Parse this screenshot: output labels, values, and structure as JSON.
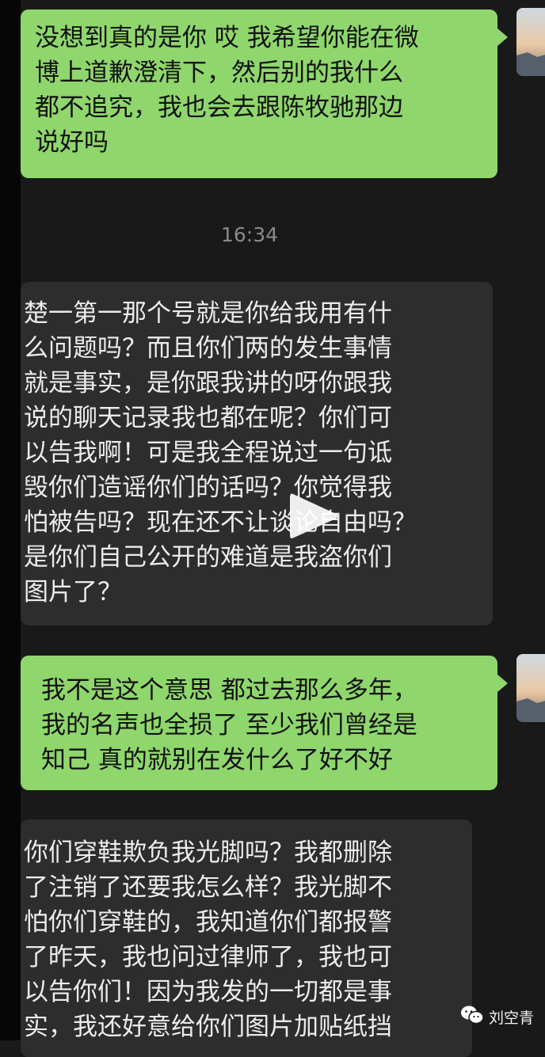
{
  "chat": {
    "messages": [
      {
        "direction": "outgoing",
        "text": "没想到真的是你 哎 我希望你能在微\n博上道歉澄清下，然后别的我什么\n都不追究，我也会去跟陈牧驰那边\n说好吗"
      },
      {
        "direction": "incoming",
        "text": "楚一第一那个号就是你给我用有什\n么问题吗？而且你们两的发生事情\n就是事实，是你跟我讲的呀你跟我\n说的聊天记录我也都在呢？你们可\n以告我啊！可是我全程说过一句诋\n毁你们造谣你们的话吗？你觉得我\n怕被告吗？现在还不让谈论自由吗？\n是你们自己公开的难道是我盗你们\n图片了？"
      },
      {
        "direction": "outgoing",
        "text": "我不是这个意思 都过去那么多年，\n我的名声也全损了 至少我们曾经是\n知己 真的就别在发什么了好不好"
      },
      {
        "direction": "incoming",
        "text": "你们穿鞋欺负我光脚吗？我都删除\n了注销了还要我怎么样？我光脚不\n怕你们穿鞋的，我知道你们都报警\n了昨天，我也问过律师了，我也可\n以告你们！因为我发的一切都是事\n实，我还好意给你们图片加贴纸挡"
      }
    ],
    "timestamp": "16:34"
  },
  "watermark": {
    "text": "刘空青",
    "icon": "wechat-icon"
  },
  "overlay": {
    "icon": "play-icon"
  },
  "colors": {
    "background": "#191919",
    "outgoing_bubble": "#8fd66d",
    "incoming_bubble": "#2d2d2d",
    "incoming_text": "#ececec",
    "timestamp": "#8a8a8a"
  }
}
